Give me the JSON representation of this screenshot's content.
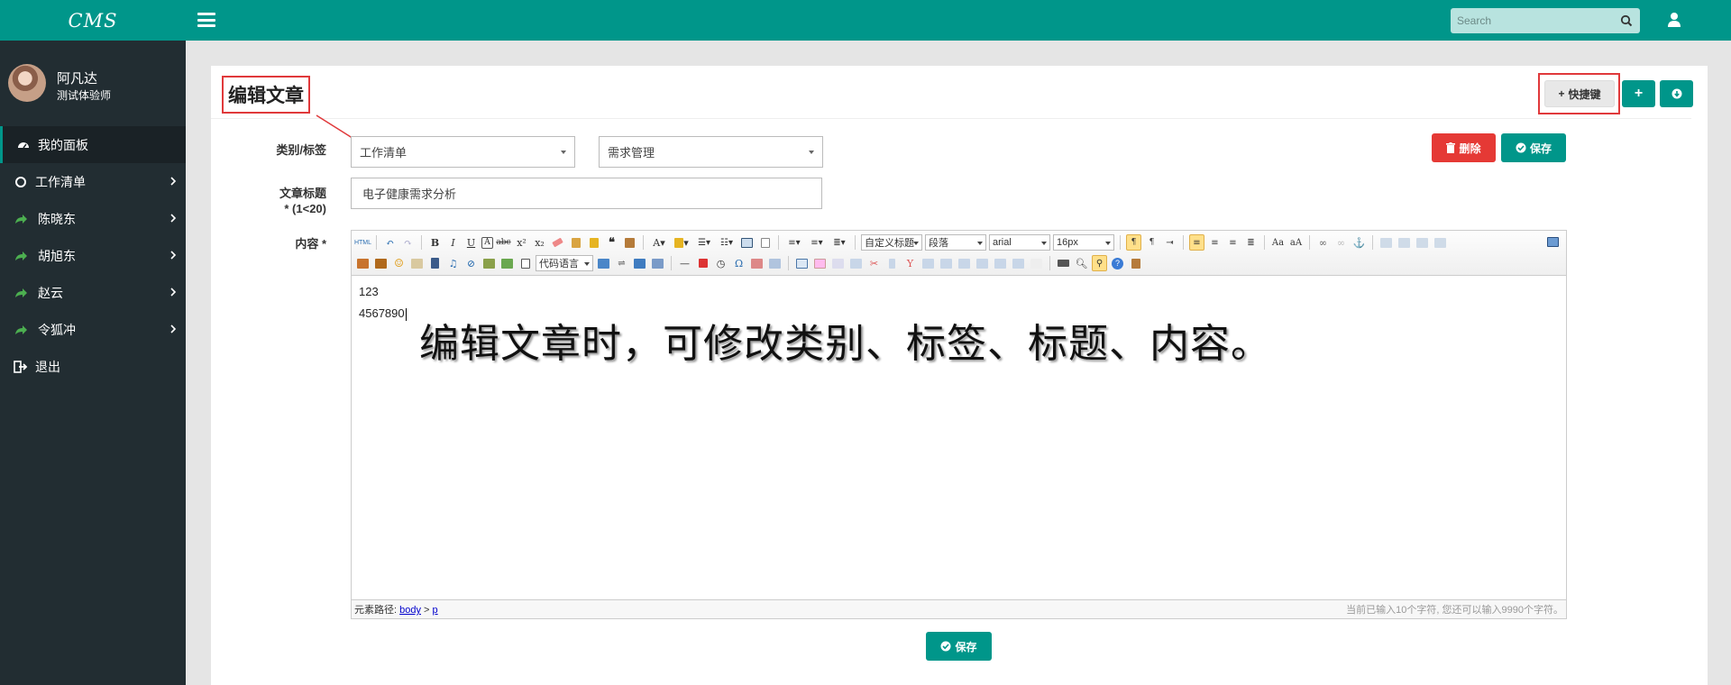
{
  "app": {
    "logo": "CMS"
  },
  "topbar": {
    "search_placeholder": "Search"
  },
  "user": {
    "name": "阿凡达",
    "role": "测试体验师"
  },
  "sidebar": {
    "items": [
      {
        "label": "我的面板",
        "icon": "dashboard-icon",
        "active": true
      },
      {
        "label": "工作清单",
        "icon": "circle-icon"
      },
      {
        "label": "陈晓东",
        "icon": "share-icon"
      },
      {
        "label": "胡旭东",
        "icon": "share-icon"
      },
      {
        "label": "赵云",
        "icon": "share-icon"
      },
      {
        "label": "令狐冲",
        "icon": "share-icon"
      },
      {
        "label": "退出",
        "icon": "logout-icon"
      }
    ]
  },
  "page": {
    "title": "编辑文章"
  },
  "header_actions": {
    "shortcut_label": "快捷键"
  },
  "actions": {
    "delete_label": "删除",
    "save_label": "保存"
  },
  "form": {
    "category_label": "类别/标签",
    "category_value": "工作清单",
    "tag_value": "需求管理",
    "title_label": "文章标题",
    "title_hint": "* (1<20)",
    "title_value": "电子健康需求分析",
    "content_label": "内容 *"
  },
  "editor": {
    "combos": {
      "custom_title": "自定义标题",
      "paragraph": "段落",
      "font_family": "arial",
      "font_size": "16px",
      "code_language": "代码语言"
    },
    "content_lines": [
      "123",
      "4567890"
    ],
    "overlay_text": "编辑文章时，可修改类别、标签、标题、内容。",
    "status_path_label": "元素路径:",
    "status_path_body": "body",
    "status_path_sep": ">",
    "status_path_p": "p",
    "status_count": "当前已输入10个字符, 您还可以输入9990个字符。"
  },
  "colors": {
    "brand": "#00968a",
    "sidebar_bg": "#222d32",
    "danger": "#e53935",
    "annotation": "#e0393b"
  }
}
